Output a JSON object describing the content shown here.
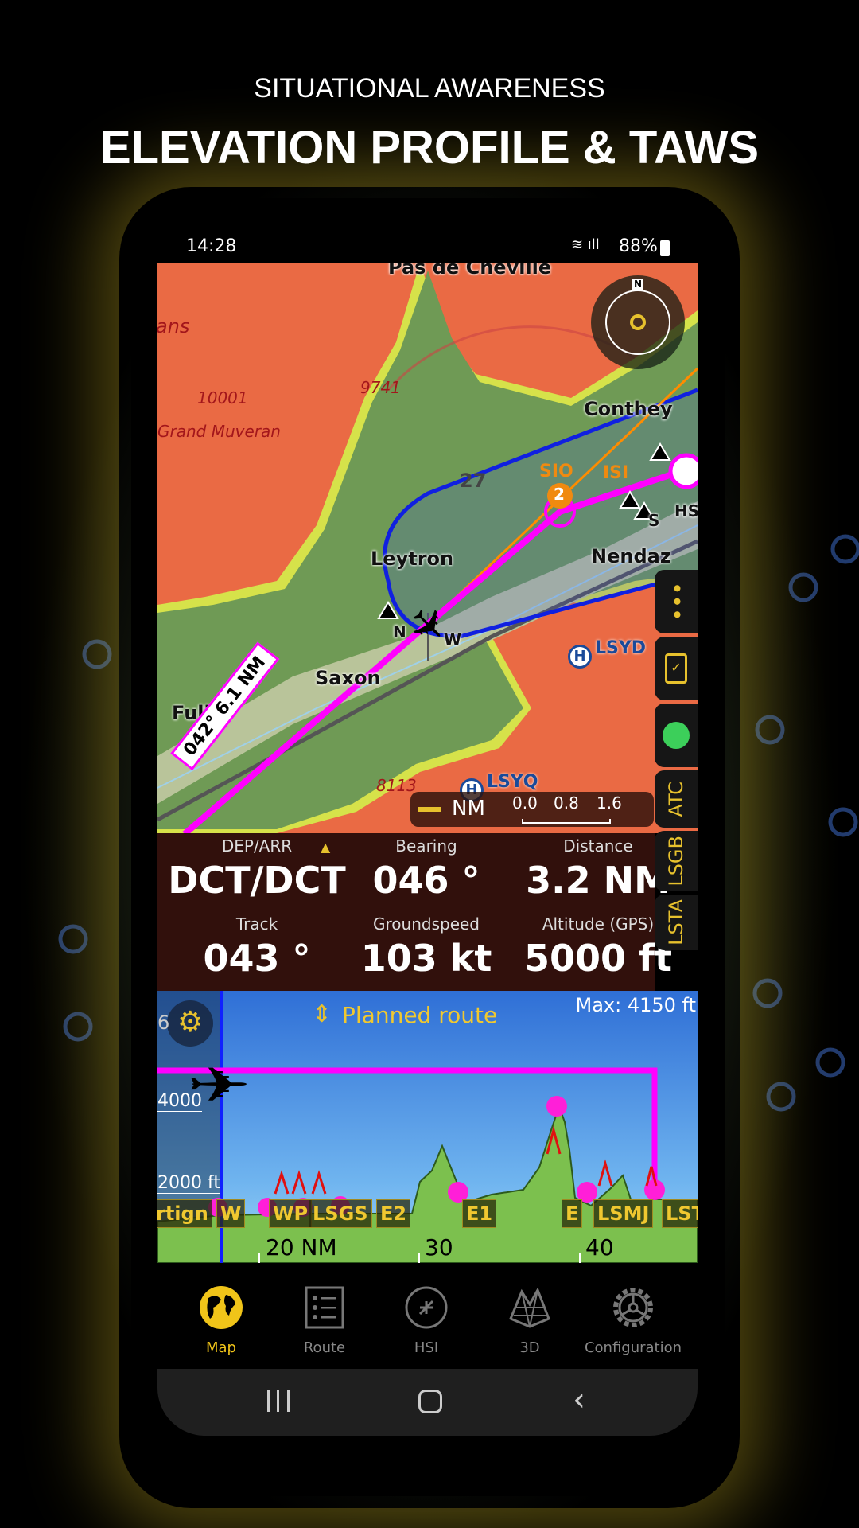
{
  "headline": {
    "kicker": "SITUATIONAL AWARENESS",
    "title": "ELEVATION PROFILE & TAWS"
  },
  "status_bar": {
    "time": "14:28",
    "battery": "88%"
  },
  "map": {
    "labels": {
      "pas": "Pas de Cheville",
      "grand": "Grand Muveran",
      "ans": "ans",
      "leytron": "Leytron",
      "nendaz": "Nendaz",
      "saxon": "Saxon",
      "fully": "Fully",
      "conthey": "Conthey",
      "s": "S",
      "hs": "HS",
      "n": "N",
      "w": "W"
    },
    "elevations": [
      "10001",
      "9741",
      "8113"
    ],
    "airports": [
      "LSYD",
      "LSYQ"
    ],
    "navaids": [
      "SIO",
      "ISI"
    ],
    "waypoint_badge": "2",
    "runway_number": "27",
    "compass_north": "N",
    "route_leg_label": "042° 6.1 NM",
    "scale": {
      "unit": "NM",
      "ticks": [
        "0.0",
        "0.8",
        "1.6"
      ]
    },
    "colors": {
      "route": "#ff00ff",
      "airspace": "#1020e0",
      "track": "#ff8c00",
      "high_terrain": "#e8633f",
      "terrain_warning": "#d8e84a"
    }
  },
  "side_buttons": {
    "atc": "ATC",
    "lsgb": "LSGB",
    "lsta": "LSTA",
    "status_color": "#3ccf5a"
  },
  "info_panel": {
    "items": [
      {
        "label": "DEP/ARR",
        "value": "DCT/DCT"
      },
      {
        "label": "Bearing",
        "value": "046 °"
      },
      {
        "label": "Distance",
        "value": "3.2 NM"
      },
      {
        "label": "Track",
        "value": "043 °"
      },
      {
        "label": "Groundspeed",
        "value": "103 kt"
      },
      {
        "label": "Altitude (GPS)",
        "value": "5000 ft"
      }
    ]
  },
  "profile": {
    "mode": "Planned route",
    "max": "Max: 4150 ft",
    "alt_labels": [
      "4000",
      "2000 ft"
    ],
    "partial_label": "6",
    "waypoints": [
      "rtign",
      "W",
      "WP",
      "LSGS",
      "E2",
      "E1",
      "E",
      "LSMJ",
      "LSTA"
    ],
    "distance_labels": [
      "20 NM",
      "30",
      "40"
    ]
  },
  "bottom_nav": {
    "active": "Map",
    "items": [
      {
        "label": "Map",
        "icon": "globe-icon"
      },
      {
        "label": "Route",
        "icon": "list-icon"
      },
      {
        "label": "HSI",
        "icon": "hsi-icon"
      },
      {
        "label": "3D",
        "icon": "terrain-mesh-icon"
      },
      {
        "label": "Configuration",
        "icon": "gear-icon"
      }
    ],
    "active_color": "#f0c419"
  }
}
